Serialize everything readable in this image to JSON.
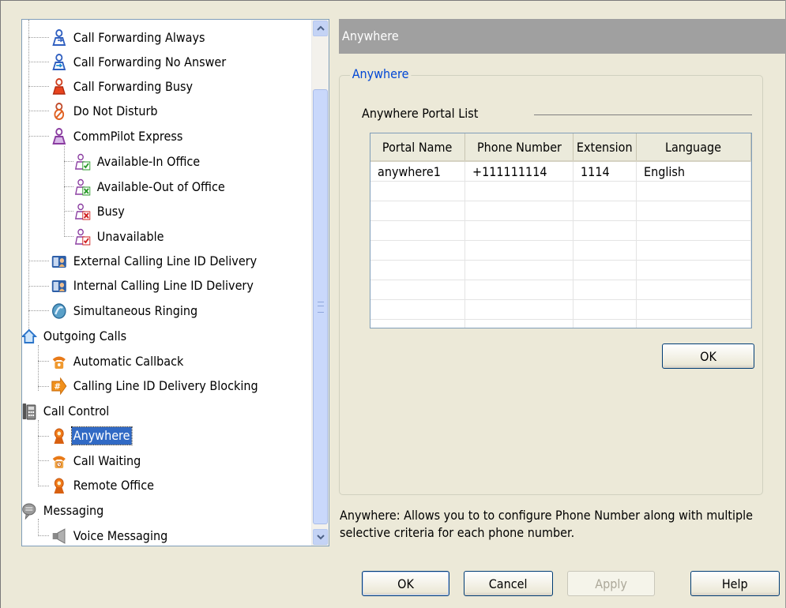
{
  "tree": {
    "items": [
      {
        "label": "Call Forwarding Always",
        "icon": "person-forward-icon"
      },
      {
        "label": "Call Forwarding No Answer",
        "icon": "person-forward-icon"
      },
      {
        "label": "Call Forwarding Busy",
        "icon": "person-busy-icon"
      },
      {
        "label": "Do Not Disturb",
        "icon": "person-dnd-icon"
      },
      {
        "label": "CommPilot Express",
        "icon": "person-express-icon"
      },
      {
        "label": "Available-In Office",
        "icon": "person-check-icon"
      },
      {
        "label": "Available-Out of Office",
        "icon": "person-check-icon"
      },
      {
        "label": "Busy",
        "icon": "person-x-icon"
      },
      {
        "label": "Unavailable",
        "icon": "person-check-icon"
      },
      {
        "label": "External Calling Line ID Delivery",
        "icon": "id-card-icon"
      },
      {
        "label": "Internal Calling Line ID Delivery",
        "icon": "id-card-icon"
      },
      {
        "label": "Simultaneous Ringing",
        "icon": "ring-icon"
      },
      {
        "label": "Outgoing Calls",
        "icon": "house-icon"
      },
      {
        "label": "Automatic Callback",
        "icon": "callback-phone-icon"
      },
      {
        "label": "Calling Line ID Delivery Blocking",
        "icon": "hash-arrow-icon"
      },
      {
        "label": "Call Control",
        "icon": "desk-phone-icon"
      },
      {
        "label": "Anywhere",
        "icon": "anywhere-icon"
      },
      {
        "label": "Call Waiting",
        "icon": "call-waiting-icon"
      },
      {
        "label": "Remote Office",
        "icon": "remote-office-icon"
      },
      {
        "label": "Messaging",
        "icon": "speech-bubble-icon"
      },
      {
        "label": "Voice Messaging",
        "icon": "speaker-icon"
      }
    ],
    "selected": "Anywhere"
  },
  "header": {
    "title": "Anywhere"
  },
  "group": {
    "title": "Anywhere"
  },
  "portal_list": {
    "label": "Anywhere Portal List",
    "columns": [
      "Portal Name",
      "Phone Number",
      "Extension",
      "Language"
    ],
    "rows": [
      [
        "anywhere1",
        "+111111114",
        "1114",
        "English"
      ]
    ],
    "ok_label": "OK"
  },
  "description": {
    "line1": "Anywhere: Allows you to to configure Phone Number along with multiple",
    "line2": "selective criteria for each phone number."
  },
  "footer": {
    "ok_label": "OK",
    "cancel_label": "Cancel",
    "apply_label": "Apply",
    "help_label": "Help"
  }
}
